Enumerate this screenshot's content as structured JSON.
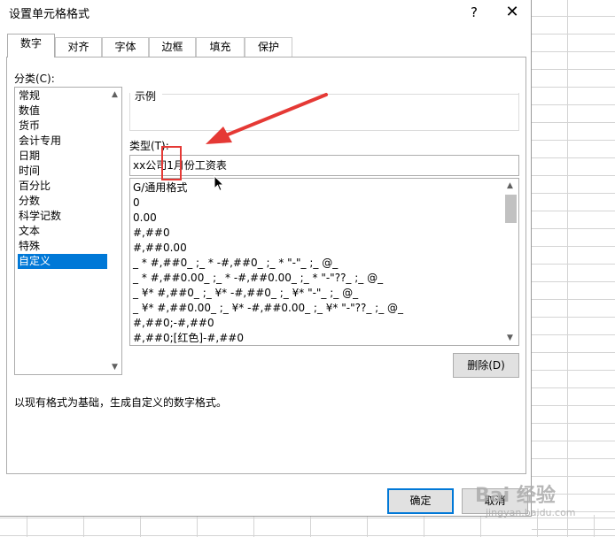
{
  "dialog": {
    "title": "设置单元格格式",
    "help_label": "?",
    "close_label": "✕"
  },
  "tabs": [
    {
      "label": "数字",
      "active": true
    },
    {
      "label": "对齐",
      "active": false
    },
    {
      "label": "字体",
      "active": false
    },
    {
      "label": "边框",
      "active": false
    },
    {
      "label": "填充",
      "active": false
    },
    {
      "label": "保护",
      "active": false
    }
  ],
  "category": {
    "label": "分类(C):",
    "items": [
      "常规",
      "数值",
      "货币",
      "会计专用",
      "日期",
      "时间",
      "百分比",
      "分数",
      "科学记数",
      "文本",
      "特殊",
      "自定义"
    ],
    "selected": "自定义"
  },
  "sample": {
    "label": "示例"
  },
  "type": {
    "label": "类型(T):",
    "value": "xx公司1月份工资表"
  },
  "formats": [
    "G/通用格式",
    "0",
    "0.00",
    "#,##0",
    "#,##0.00",
    "_ * #,##0_ ;_ * -#,##0_ ;_ * \"-\"_ ;_ @_",
    "_ * #,##0.00_ ;_ * -#,##0.00_ ;_ * \"-\"??_ ;_ @_",
    "_ ¥* #,##0_ ;_ ¥* -#,##0_ ;_ ¥* \"-\"_ ;_ @_",
    "_ ¥* #,##0.00_ ;_ ¥* -#,##0.00_ ;_ ¥* \"-\"??_ ;_ @_",
    "#,##0;-#,##0",
    "#,##0;[红色]-#,##0"
  ],
  "buttons": {
    "delete": "删除(D)",
    "ok": "确定",
    "cancel": "取消"
  },
  "description": "以现有格式为基础，生成自定义的数字格式。",
  "watermark": {
    "main": "Bai 经验",
    "sub": "jingyan.baidu.com"
  },
  "colors": {
    "accent": "#0078d7",
    "annotation": "#e53935"
  }
}
